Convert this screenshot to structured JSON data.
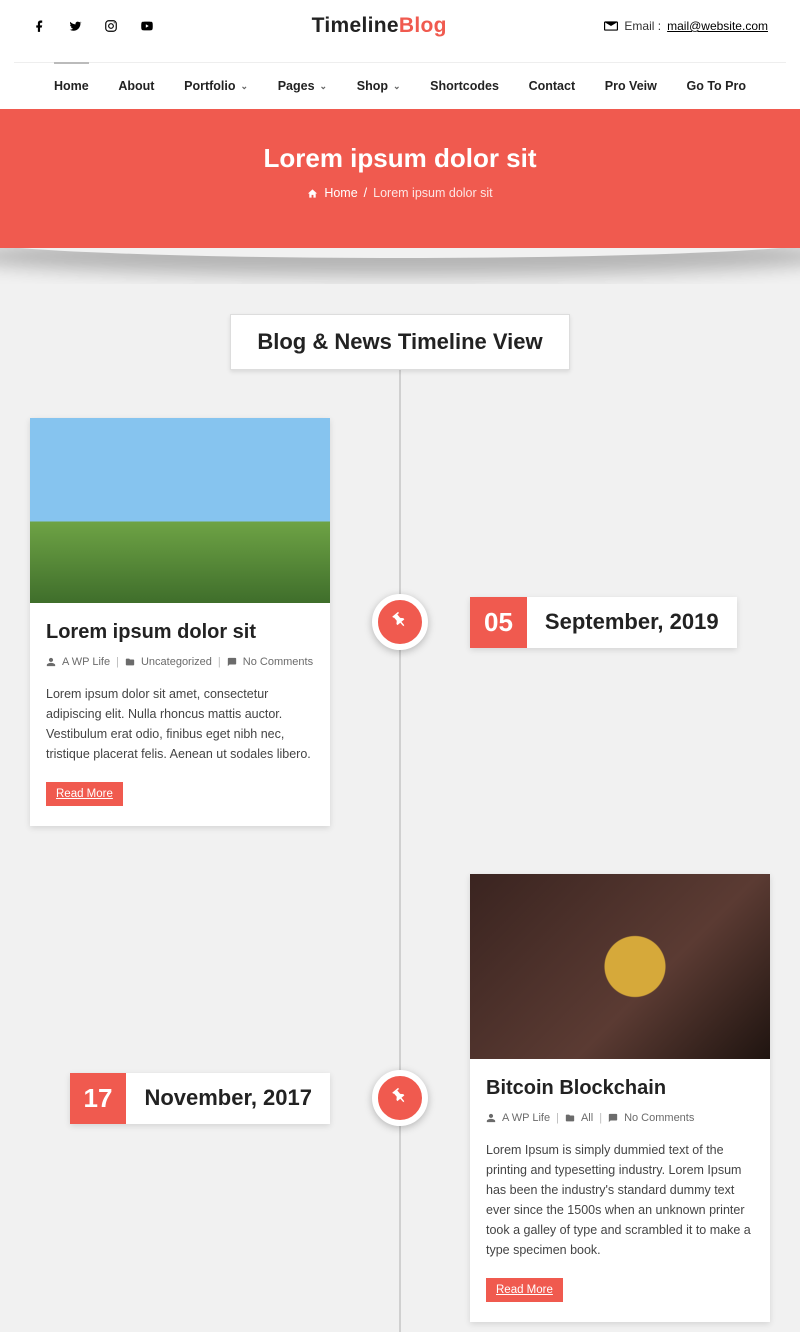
{
  "brand": {
    "a": "Timeline",
    "b": "Blog"
  },
  "header": {
    "email_label": "Email :",
    "email": "mail@website.com"
  },
  "nav": {
    "items": [
      "Home",
      "About",
      "Portfolio",
      "Pages",
      "Shop",
      "Shortcodes",
      "Contact",
      "Pro Veiw",
      "Go To Pro"
    ],
    "has_sub": [
      false,
      false,
      true,
      true,
      true,
      false,
      false,
      false,
      false
    ],
    "current": 0
  },
  "hero": {
    "title": "Lorem ipsum dolor sit",
    "home": "Home",
    "current": "Lorem ipsum dolor sit"
  },
  "section_title": "Blog & News Timeline View",
  "labels": {
    "author": "A WP Life",
    "no_comments": "No Comments",
    "read_more": "Read More"
  },
  "posts": [
    {
      "side": "left",
      "img": "people",
      "title": "Lorem ipsum dolor sit",
      "category": "Uncategorized",
      "excerpt": "Lorem ipsum dolor sit amet, consectetur adipiscing elit. Nulla rhoncus mattis auctor. Vestibulum erat odio, finibus eget nibh nec, tristique placerat felis. Aenean ut sodales libero.",
      "day": "05",
      "month_year": "September, 2019"
    },
    {
      "side": "right",
      "img": "coin",
      "title": "Bitcoin Blockchain",
      "category": "All",
      "excerpt": "Lorem Ipsum is simply dummied text of the printing and typesetting industry. Lorem Ipsum has been the industry's standard dummy text ever since the 1500s when an unknown printer took a galley of type and scrambled it to make a type specimen book.",
      "day": "17",
      "month_year": "November, 2017"
    }
  ]
}
